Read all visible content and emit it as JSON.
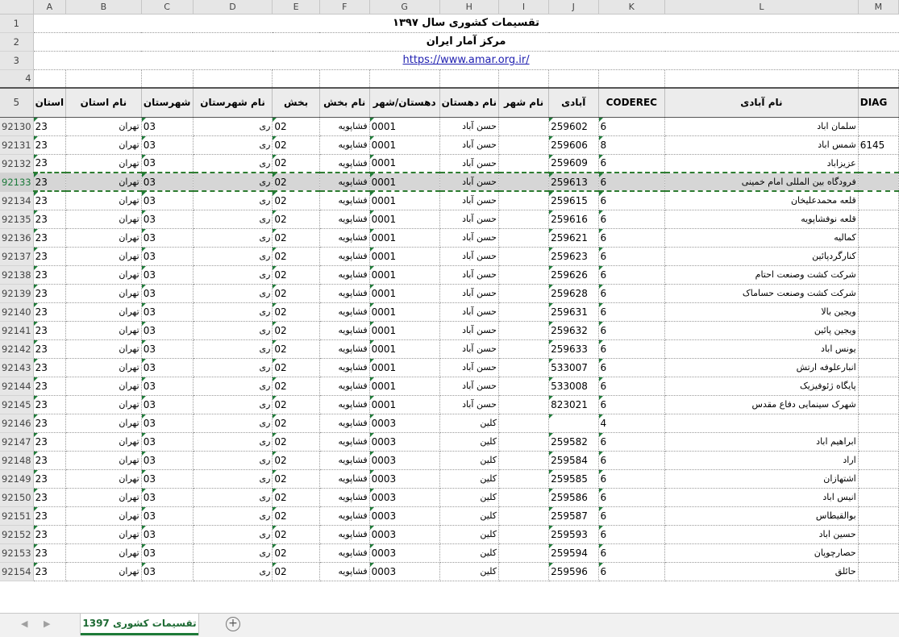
{
  "columns": [
    "A",
    "B",
    "C",
    "D",
    "E",
    "F",
    "G",
    "H",
    "I",
    "J",
    "K",
    "L",
    "M"
  ],
  "title_rows": {
    "title": "تقسیمات کشوری سال ۱۳۹۷",
    "subtitle": "مرکز آمار ایران",
    "url": "https://www.amar.org.ir/"
  },
  "row_numbers": [
    "1",
    "2",
    "3",
    "4",
    "5"
  ],
  "headers": [
    "استان",
    "نام استان",
    "شهرستان",
    "نام شهرستان",
    "بخش",
    "نام بخش",
    "دهستان/شهر",
    "نام دهستان",
    "نام شهر",
    "آبادی",
    "CODEREC",
    "نام آبادی",
    "DIAG"
  ],
  "rows": [
    {
      "r": "92130",
      "a": "23",
      "b": "تهران",
      "c": "03",
      "d": "ری",
      "e": "02",
      "f": "فشاپویه",
      "g": "0001",
      "h": "حسن آباد",
      "i": "",
      "j": "259602",
      "k": "6",
      "l": "سلمان اباد",
      "m": ""
    },
    {
      "r": "92131",
      "a": "23",
      "b": "تهران",
      "c": "03",
      "d": "ری",
      "e": "02",
      "f": "فشاپویه",
      "g": "0001",
      "h": "حسن آباد",
      "i": "",
      "j": "259606",
      "k": "8",
      "l": "شمس اباد",
      "m": "6145"
    },
    {
      "r": "92132",
      "a": "23",
      "b": "تهران",
      "c": "03",
      "d": "ری",
      "e": "02",
      "f": "فشاپویه",
      "g": "0001",
      "h": "حسن آباد",
      "i": "",
      "j": "259609",
      "k": "6",
      "l": "عزیزاباد",
      "m": ""
    },
    {
      "r": "92133",
      "a": "23",
      "b": "تهران",
      "c": "03",
      "d": "ری",
      "e": "02",
      "f": "فشاپویه",
      "g": "0001",
      "h": "حسن آباد",
      "i": "",
      "j": "259613",
      "k": "6",
      "l": "فرودگاه بین المللی امام خمینی",
      "m": ""
    },
    {
      "r": "92134",
      "a": "23",
      "b": "تهران",
      "c": "03",
      "d": "ری",
      "e": "02",
      "f": "فشاپویه",
      "g": "0001",
      "h": "حسن آباد",
      "i": "",
      "j": "259615",
      "k": "6",
      "l": "قلعه محمدعلیخان",
      "m": ""
    },
    {
      "r": "92135",
      "a": "23",
      "b": "تهران",
      "c": "03",
      "d": "ری",
      "e": "02",
      "f": "فشاپویه",
      "g": "0001",
      "h": "حسن آباد",
      "i": "",
      "j": "259616",
      "k": "6",
      "l": "قلعه نوفشاپویه",
      "m": ""
    },
    {
      "r": "92136",
      "a": "23",
      "b": "تهران",
      "c": "03",
      "d": "ری",
      "e": "02",
      "f": "فشاپویه",
      "g": "0001",
      "h": "حسن آباد",
      "i": "",
      "j": "259621",
      "k": "6",
      "l": "کمالیه",
      "m": ""
    },
    {
      "r": "92137",
      "a": "23",
      "b": "تهران",
      "c": "03",
      "d": "ری",
      "e": "02",
      "f": "فشاپویه",
      "g": "0001",
      "h": "حسن آباد",
      "i": "",
      "j": "259623",
      "k": "6",
      "l": "کنارگردپائین",
      "m": ""
    },
    {
      "r": "92138",
      "a": "23",
      "b": "تهران",
      "c": "03",
      "d": "ری",
      "e": "02",
      "f": "فشاپویه",
      "g": "0001",
      "h": "حسن آباد",
      "i": "",
      "j": "259626",
      "k": "6",
      "l": "شرکت کشت وصنعت احتام",
      "m": ""
    },
    {
      "r": "92139",
      "a": "23",
      "b": "تهران",
      "c": "03",
      "d": "ری",
      "e": "02",
      "f": "فشاپویه",
      "g": "0001",
      "h": "حسن آباد",
      "i": "",
      "j": "259628",
      "k": "6",
      "l": "شرکت کشت وصنعت حساماک",
      "m": ""
    },
    {
      "r": "92140",
      "a": "23",
      "b": "تهران",
      "c": "03",
      "d": "ری",
      "e": "02",
      "f": "فشاپویه",
      "g": "0001",
      "h": "حسن آباد",
      "i": "",
      "j": "259631",
      "k": "6",
      "l": "ویجین بالا",
      "m": ""
    },
    {
      "r": "92141",
      "a": "23",
      "b": "تهران",
      "c": "03",
      "d": "ری",
      "e": "02",
      "f": "فشاپویه",
      "g": "0001",
      "h": "حسن آباد",
      "i": "",
      "j": "259632",
      "k": "6",
      "l": "ویجین پائین",
      "m": ""
    },
    {
      "r": "92142",
      "a": "23",
      "b": "تهران",
      "c": "03",
      "d": "ری",
      "e": "02",
      "f": "فشاپویه",
      "g": "0001",
      "h": "حسن آباد",
      "i": "",
      "j": "259633",
      "k": "6",
      "l": "یونس اباد",
      "m": ""
    },
    {
      "r": "92143",
      "a": "23",
      "b": "تهران",
      "c": "03",
      "d": "ری",
      "e": "02",
      "f": "فشاپویه",
      "g": "0001",
      "h": "حسن آباد",
      "i": "",
      "j": "533007",
      "k": "6",
      "l": "انبارعلوفه ارتش",
      "m": ""
    },
    {
      "r": "92144",
      "a": "23",
      "b": "تهران",
      "c": "03",
      "d": "ری",
      "e": "02",
      "f": "فشاپویه",
      "g": "0001",
      "h": "حسن آباد",
      "i": "",
      "j": "533008",
      "k": "6",
      "l": "پایگاه ژئوفیزیک",
      "m": ""
    },
    {
      "r": "92145",
      "a": "23",
      "b": "تهران",
      "c": "03",
      "d": "ری",
      "e": "02",
      "f": "فشاپویه",
      "g": "0001",
      "h": "حسن آباد",
      "i": "",
      "j": "823021",
      "k": "6",
      "l": "شهرک سینمایی دفاع مقدس",
      "m": ""
    },
    {
      "r": "92146",
      "a": "23",
      "b": "تهران",
      "c": "03",
      "d": "ری",
      "e": "02",
      "f": "فشاپویه",
      "g": "0003",
      "h": "کلین",
      "i": "",
      "j": "",
      "k": "4",
      "l": "",
      "m": ""
    },
    {
      "r": "92147",
      "a": "23",
      "b": "تهران",
      "c": "03",
      "d": "ری",
      "e": "02",
      "f": "فشاپویه",
      "g": "0003",
      "h": "کلین",
      "i": "",
      "j": "259582",
      "k": "6",
      "l": "ابراهیم اباد",
      "m": ""
    },
    {
      "r": "92148",
      "a": "23",
      "b": "تهران",
      "c": "03",
      "d": "ری",
      "e": "02",
      "f": "فشاپویه",
      "g": "0003",
      "h": "کلین",
      "i": "",
      "j": "259584",
      "k": "6",
      "l": "اراد",
      "m": ""
    },
    {
      "r": "92149",
      "a": "23",
      "b": "تهران",
      "c": "03",
      "d": "ری",
      "e": "02",
      "f": "فشاپویه",
      "g": "0003",
      "h": "کلین",
      "i": "",
      "j": "259585",
      "k": "6",
      "l": "اشتهازان",
      "m": ""
    },
    {
      "r": "92150",
      "a": "23",
      "b": "تهران",
      "c": "03",
      "d": "ری",
      "e": "02",
      "f": "فشاپویه",
      "g": "0003",
      "h": "کلین",
      "i": "",
      "j": "259586",
      "k": "6",
      "l": "انیس اباد",
      "m": ""
    },
    {
      "r": "92151",
      "a": "23",
      "b": "تهران",
      "c": "03",
      "d": "ری",
      "e": "02",
      "f": "فشاپویه",
      "g": "0003",
      "h": "کلین",
      "i": "",
      "j": "259587",
      "k": "6",
      "l": "بوالقیطاس",
      "m": ""
    },
    {
      "r": "92152",
      "a": "23",
      "b": "تهران",
      "c": "03",
      "d": "ری",
      "e": "02",
      "f": "فشاپویه",
      "g": "0003",
      "h": "کلین",
      "i": "",
      "j": "259593",
      "k": "6",
      "l": "حسین اباد",
      "m": ""
    },
    {
      "r": "92153",
      "a": "23",
      "b": "تهران",
      "c": "03",
      "d": "ری",
      "e": "02",
      "f": "فشاپویه",
      "g": "0003",
      "h": "کلین",
      "i": "",
      "j": "259594",
      "k": "6",
      "l": "حصارچوپان",
      "m": ""
    },
    {
      "r": "92154",
      "a": "23",
      "b": "تهران",
      "c": "03",
      "d": "ری",
      "e": "02",
      "f": "فشاپویه",
      "g": "0003",
      "h": "کلین",
      "i": "",
      "j": "259596",
      "k": "6",
      "l": "حائلق",
      "m": ""
    }
  ],
  "selected_row": "92133",
  "sheet_tab": "تقسیمات کشوری 1397",
  "icons": {
    "prev": "triangle-left-icon",
    "next": "triangle-right-icon",
    "add": "plus-circle-icon"
  },
  "colors": {
    "accent": "#1e7a38",
    "link": "#1f1fb0"
  }
}
